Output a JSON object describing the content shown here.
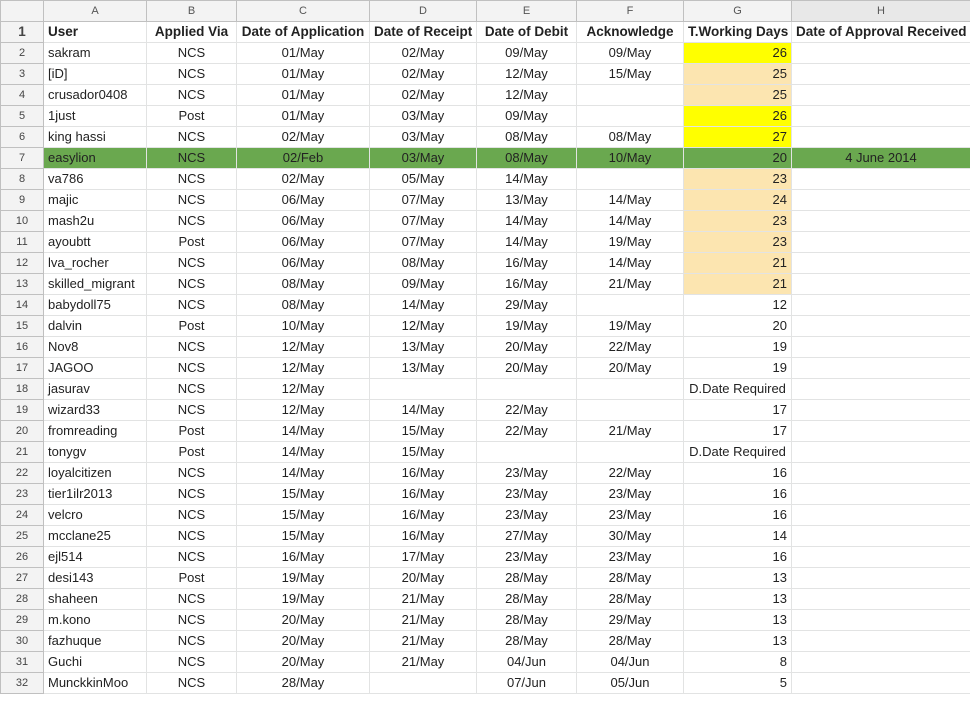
{
  "colors": {
    "green_row": "#6aa84f",
    "orange_cell": "#fce5b0",
    "yellow_cell": "#ffff00"
  },
  "column_letters": [
    "A",
    "B",
    "C",
    "D",
    "E",
    "F",
    "G",
    "H"
  ],
  "header_row": [
    "User",
    "Applied Via",
    "Date of Application",
    "Date of Receipt",
    "Date of Debit",
    "Acknowledge",
    "T.Working Days",
    "Date of Approval Received"
  ],
  "rows": [
    {
      "n": "2",
      "cells": [
        "sakram",
        "NCS",
        "01/May",
        "02/May",
        "09/May",
        "09/May",
        "26",
        ""
      ],
      "g": "yellow"
    },
    {
      "n": "3",
      "cells": [
        "[iD]",
        "NCS",
        "01/May",
        "02/May",
        "12/May",
        "15/May",
        "25",
        ""
      ],
      "g": "orange"
    },
    {
      "n": "4",
      "cells": [
        "crusador0408",
        "NCS",
        "01/May",
        "02/May",
        "12/May",
        "",
        "25",
        ""
      ],
      "g": "orange"
    },
    {
      "n": "5",
      "cells": [
        "1just",
        "Post",
        "01/May",
        "03/May",
        "09/May",
        "",
        "26",
        ""
      ],
      "g": "yellow"
    },
    {
      "n": "6",
      "cells": [
        "king hassi",
        "NCS",
        "02/May",
        "03/May",
        "08/May",
        "08/May",
        "27",
        ""
      ],
      "g": "yellow"
    },
    {
      "n": "7",
      "cells": [
        "easylion",
        "NCS",
        "02/Feb",
        "03/May",
        "08/May",
        "10/May",
        "20",
        "4 June 2014"
      ],
      "g": "green"
    },
    {
      "n": "8",
      "cells": [
        "va786",
        "NCS",
        "02/May",
        "05/May",
        "14/May",
        "",
        "23",
        ""
      ],
      "g": "orange"
    },
    {
      "n": "9",
      "cells": [
        "majic",
        "NCS",
        "06/May",
        "07/May",
        "13/May",
        "14/May",
        "24",
        ""
      ],
      "g": "orange"
    },
    {
      "n": "10",
      "cells": [
        "mash2u",
        "NCS",
        "06/May",
        "07/May",
        "14/May",
        "14/May",
        "23",
        ""
      ],
      "g": "orange"
    },
    {
      "n": "11",
      "cells": [
        "ayoubtt",
        "Post",
        "06/May",
        "07/May",
        "14/May",
        "19/May",
        "23",
        ""
      ],
      "g": "orange"
    },
    {
      "n": "12",
      "cells": [
        "lva_rocher",
        "NCS",
        "06/May",
        "08/May",
        "16/May",
        "14/May",
        "21",
        ""
      ],
      "g": "orange"
    },
    {
      "n": "13",
      "cells": [
        "skilled_migrant",
        "NCS",
        "08/May",
        "09/May",
        "16/May",
        "21/May",
        "21",
        ""
      ],
      "g": "orange"
    },
    {
      "n": "14",
      "cells": [
        "babydoll75",
        "NCS",
        "08/May",
        "14/May",
        "29/May",
        "",
        "12",
        ""
      ],
      "g": ""
    },
    {
      "n": "15",
      "cells": [
        "dalvin",
        "Post",
        "10/May",
        "12/May",
        "19/May",
        "19/May",
        "20",
        ""
      ],
      "g": ""
    },
    {
      "n": "16",
      "cells": [
        "Nov8",
        "NCS",
        "12/May",
        "13/May",
        "20/May",
        "22/May",
        "19",
        ""
      ],
      "g": ""
    },
    {
      "n": "17",
      "cells": [
        "JAGOO",
        "NCS",
        "12/May",
        "13/May",
        "20/May",
        "20/May",
        "19",
        ""
      ],
      "g": ""
    },
    {
      "n": "18",
      "cells": [
        "jasurav",
        "NCS",
        "12/May",
        "",
        "",
        "",
        "D.Date Required",
        ""
      ],
      "g": "text"
    },
    {
      "n": "19",
      "cells": [
        "wizard33",
        "NCS",
        "12/May",
        "14/May",
        "22/May",
        "",
        "17",
        ""
      ],
      "g": ""
    },
    {
      "n": "20",
      "cells": [
        "fromreading",
        "Post",
        "14/May",
        "15/May",
        "22/May",
        "21/May",
        "17",
        ""
      ],
      "g": ""
    },
    {
      "n": "21",
      "cells": [
        "tonygv",
        "Post",
        "14/May",
        "15/May",
        "",
        "",
        "D.Date Required",
        ""
      ],
      "g": "text"
    },
    {
      "n": "22",
      "cells": [
        "loyalcitizen",
        "NCS",
        "14/May",
        "16/May",
        "23/May",
        "22/May",
        "16",
        ""
      ],
      "g": ""
    },
    {
      "n": "23",
      "cells": [
        "tier1ilr2013",
        "NCS",
        "15/May",
        "16/May",
        "23/May",
        "23/May",
        "16",
        ""
      ],
      "g": ""
    },
    {
      "n": "24",
      "cells": [
        "velcro",
        "NCS",
        "15/May",
        "16/May",
        "23/May",
        "23/May",
        "16",
        ""
      ],
      "g": ""
    },
    {
      "n": "25",
      "cells": [
        "mcclane25",
        "NCS",
        "15/May",
        "16/May",
        "27/May",
        "30/May",
        "14",
        ""
      ],
      "g": ""
    },
    {
      "n": "26",
      "cells": [
        "ejl514",
        "NCS",
        "16/May",
        "17/May",
        "23/May",
        "23/May",
        "16",
        ""
      ],
      "g": ""
    },
    {
      "n": "27",
      "cells": [
        "desi143",
        "Post",
        "19/May",
        "20/May",
        "28/May",
        "28/May",
        "13",
        ""
      ],
      "g": ""
    },
    {
      "n": "28",
      "cells": [
        "shaheen",
        "NCS",
        "19/May",
        "21/May",
        "28/May",
        "28/May",
        "13",
        ""
      ],
      "g": ""
    },
    {
      "n": "29",
      "cells": [
        "m.kono",
        "NCS",
        "20/May",
        "21/May",
        "28/May",
        "29/May",
        "13",
        ""
      ],
      "g": ""
    },
    {
      "n": "30",
      "cells": [
        "fazhuque",
        "NCS",
        "20/May",
        "21/May",
        "28/May",
        "28/May",
        "13",
        ""
      ],
      "g": ""
    },
    {
      "n": "31",
      "cells": [
        "Guchi",
        "NCS",
        "20/May",
        "21/May",
        "04/Jun",
        "04/Jun",
        "8",
        ""
      ],
      "g": ""
    },
    {
      "n": "32",
      "cells": [
        "MunckkinMoo",
        "NCS",
        "28/May",
        "",
        "07/Jun",
        "05/Jun",
        "5",
        ""
      ],
      "g": ""
    }
  ]
}
